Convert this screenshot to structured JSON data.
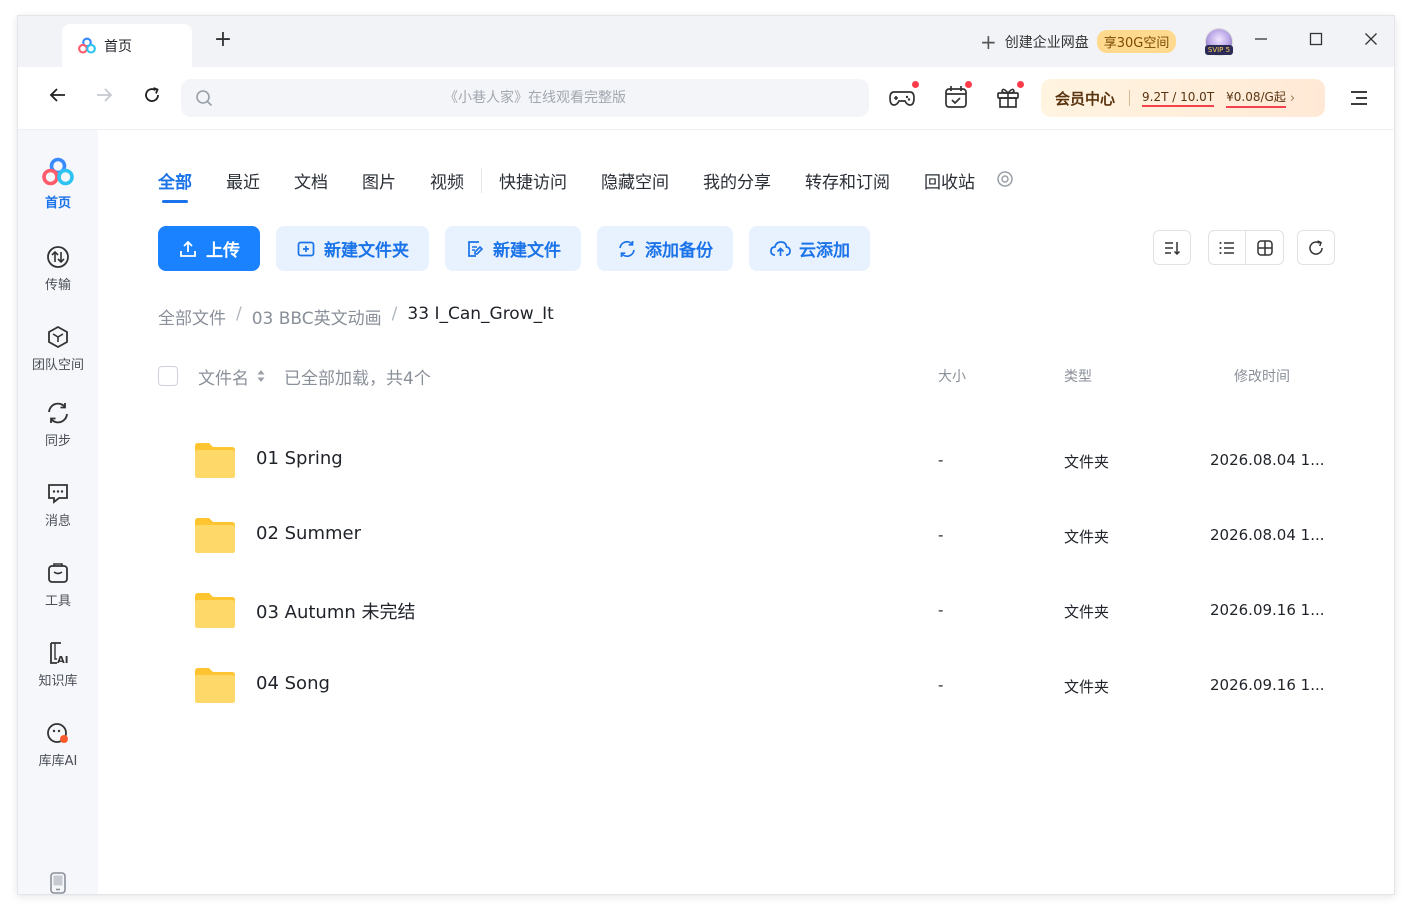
{
  "titlebar": {
    "tab_label": "首页",
    "new_tab_symbol": "+",
    "enterprise_label": "创建企业网盘",
    "enterprise_badge": "享30G空间",
    "avatar_tag": "SVIP 5"
  },
  "toolbar": {
    "search_placeholder": "《小巷人家》在线观看完整版",
    "member_title": "会员中心",
    "member_quota": "9.2T / 10.0T",
    "member_price": "¥0.08/G起",
    "member_chevron": "›"
  },
  "sidebar": {
    "items": [
      {
        "label": "首页",
        "icon": "home-logo-icon"
      },
      {
        "label": "传输",
        "icon": "transfer-icon"
      },
      {
        "label": "团队空间",
        "icon": "team-space-icon"
      },
      {
        "label": "同步",
        "icon": "sync-icon"
      },
      {
        "label": "消息",
        "icon": "message-icon"
      },
      {
        "label": "工具",
        "icon": "tools-icon"
      },
      {
        "label": "知识库",
        "icon": "knowledge-base-icon"
      },
      {
        "label": "库库AI",
        "icon": "kuku-ai-icon"
      }
    ]
  },
  "main": {
    "tabs": [
      "全部",
      "最近",
      "文档",
      "图片",
      "视频",
      "快捷访问",
      "隐藏空间",
      "我的分享",
      "转存和订阅",
      "回收站"
    ],
    "actions": {
      "upload": "上传",
      "new_folder": "新建文件夹",
      "new_file": "新建文件",
      "add_backup": "添加备份",
      "cloud_add": "云添加"
    },
    "breadcrumb": {
      "root": "全部文件",
      "level1": "03 BBC英文动画",
      "current": "33 I_Can_Grow_It",
      "separator": "/"
    },
    "table": {
      "col_name": "文件名",
      "load_status": "已全部加载，共4个",
      "col_size": "大小",
      "col_type": "类型",
      "col_mtime": "修改时间",
      "rows": [
        {
          "name": "01 Spring",
          "size": "-",
          "type": "文件夹",
          "mtime": "2026.08.04 1..."
        },
        {
          "name": "02 Summer",
          "size": "-",
          "type": "文件夹",
          "mtime": "2026.08.04 1..."
        },
        {
          "name": "03 Autumn 未完结",
          "size": "-",
          "type": "文件夹",
          "mtime": "2026.09.16 1..."
        },
        {
          "name": "04 Song",
          "size": "-",
          "type": "文件夹",
          "mtime": "2026.09.16 1..."
        }
      ]
    }
  },
  "colors": {
    "accent": "#1a73e8",
    "primary_button": "#1a82ff",
    "folder": "#ffc94a",
    "notification_dot": "#ff3b4a"
  }
}
